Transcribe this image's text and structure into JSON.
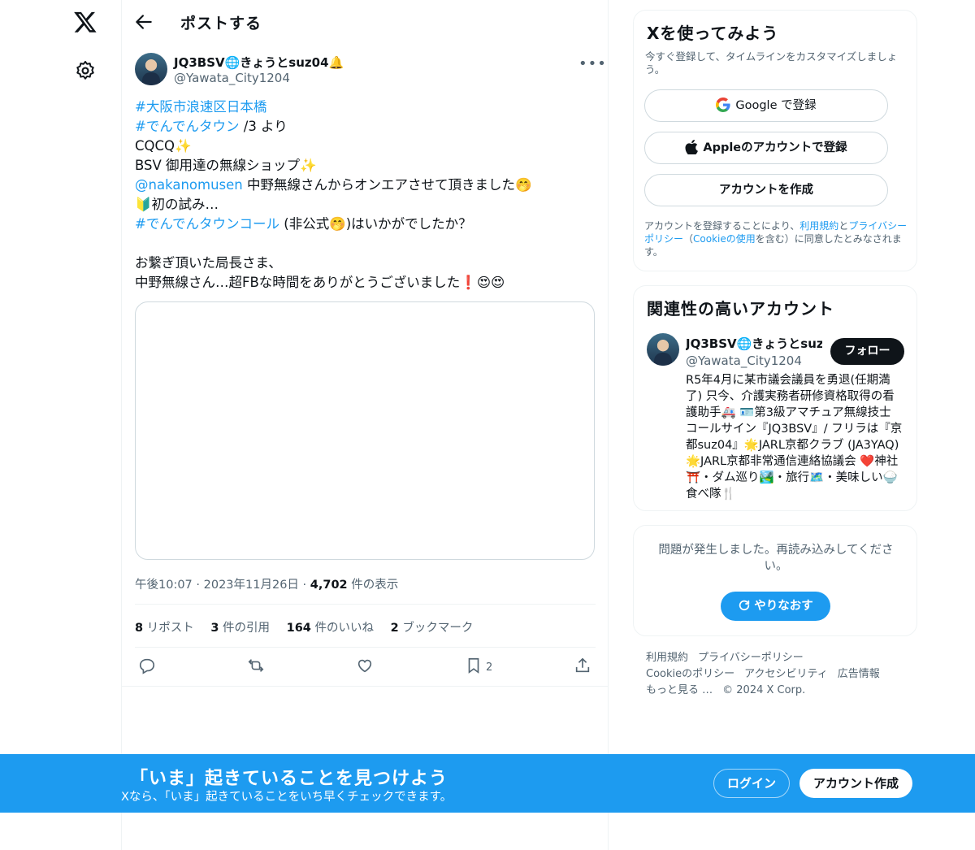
{
  "header": {
    "title": "ポストする"
  },
  "post": {
    "author_name": "JQ3BSV🌐きょうとsuz04🔔",
    "author_handle": "@Yawata_City1204",
    "lines": [
      [
        "#大阪市浪速区日本橋",
        ""
      ],
      [
        "#でんでんタウン",
        " /3 より"
      ],
      [
        "",
        "CQCQ✨"
      ],
      [
        "",
        "BSV 御用達の無線ショップ✨"
      ],
      [
        "@nakanomusen",
        " 中野無線さんからオンエアさせて頂きました🤭"
      ],
      [
        "",
        "🔰初の試み…"
      ],
      [
        "#でんでんタウンコール",
        " (非公式🤭)はいかがでしたか？"
      ],
      [
        "",
        ""
      ],
      [
        "",
        "お繋ぎ頂いた局長さま、"
      ],
      [
        "",
        "中野無線さん…超FBな時間をありがとうございました❗😍😍"
      ]
    ],
    "time": "午後10:07",
    "date": "2023年11月26日",
    "views_count": "4,702",
    "views_label": "件の表示",
    "stats": {
      "reposts_count": "8",
      "reposts_label": "リポスト",
      "quotes_count": "3",
      "quotes_label": "件の引用",
      "likes_count": "164",
      "likes_label": "件のいいね",
      "bookmarks_count": "2",
      "bookmarks_label": "ブックマーク"
    },
    "bookmark_count": "2"
  },
  "signup_card": {
    "title": "Xを使ってみよう",
    "subtitle": "今すぐ登録して、タイムラインをカスタマイズしましょう。",
    "google_label": "Google で登録",
    "apple_label": "Appleのアカウントで登録",
    "create_label": "アカウントを作成",
    "terms_prefix": "アカウントを登録することにより、",
    "terms_link": "利用規約",
    "terms_and": "と",
    "privacy_link": "プライバシーポリシー",
    "terms_mid": "（",
    "cookie_link": "Cookieの使用",
    "terms_suffix": "を含む）に同意したとみなされます。"
  },
  "related_card": {
    "title": "関連性の高いアカウント",
    "name": "JQ3BSV🌐きょうとsuz04🔔",
    "handle": "@Yawata_City1204",
    "follow_label": "フォロー",
    "bio": "R5年4月に某市議会議員を勇退(任期満了) 只今、介護実務者研修資格取得の看護助手🚑 🪪第3級アマチュア無線技士 コールサイン『JQ3BSV』/ フリラは『京都suz04』🌟JARL京都クラブ (JA3YAQ) 🌟JARL京都非常通信連絡協議会 ❤️神社⛩️・ダム巡り🏞️・旅行🗺️・美味しい🍚食べ隊🍴"
  },
  "error_card": {
    "message": "問題が発生しました。再読み込みしてください。",
    "retry_label": "やりなおす"
  },
  "footer": {
    "links": [
      "利用規約",
      "プライバシーポリシー",
      "Cookieのポリシー",
      "アクセシビリティ",
      "広告情報",
      "もっと見る …"
    ],
    "copyright": "© 2024 X Corp."
  },
  "banner": {
    "title": "「いま」起きていることを見つけよう",
    "subtitle": "Xなら、「いま」起きていることをいち早くチェックできます。",
    "login_label": "ログイン",
    "signup_label": "アカウント作成"
  },
  "colors": {
    "accent": "#1d9bf0",
    "text": "#0f1419",
    "muted": "#536471",
    "border": "#eff3f4"
  }
}
